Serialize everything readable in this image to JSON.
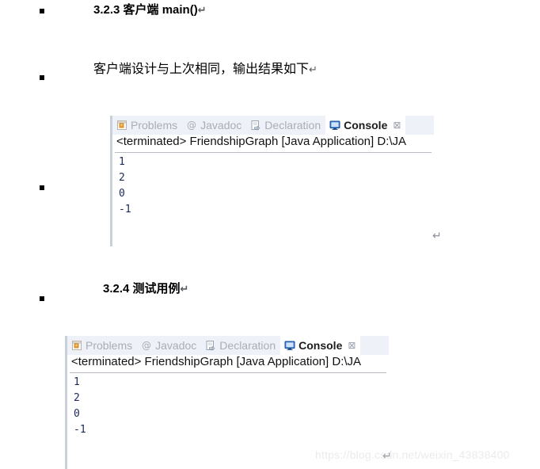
{
  "document": {
    "headings": [
      {
        "number": "3.2.3",
        "text": "客户端 main()",
        "mark": "↵"
      },
      {
        "number": "3.2.4",
        "text": "测试用例",
        "mark": "↵"
      }
    ],
    "paragraph": {
      "text": "客户端设计与上次相同，输出结果如下",
      "mark": "↵"
    },
    "heading_1_full": "3.2.3 客户端 main()",
    "heading_2_full": "3.2.4 测试用例",
    "loose_pilcrow": "↵"
  },
  "console_panels": [
    {
      "tabs": [
        {
          "icon": "problems-icon",
          "label": "Problems",
          "active": false
        },
        {
          "icon": "javadoc-icon",
          "label": "Javadoc",
          "active": false
        },
        {
          "icon": "declaration-icon",
          "label": "Declaration",
          "active": false
        },
        {
          "icon": "console-icon",
          "label": "Console",
          "active": true,
          "close": "⊠"
        }
      ],
      "launch_line": "<terminated> FriendshipGraph [Java Application] D:\\JA",
      "output_lines": [
        "1",
        "2",
        "0",
        "-1"
      ]
    },
    {
      "tabs": [
        {
          "icon": "problems-icon",
          "label": "Problems",
          "active": false
        },
        {
          "icon": "javadoc-icon",
          "label": "Javadoc",
          "active": false
        },
        {
          "icon": "declaration-icon",
          "label": "Declaration",
          "active": false
        },
        {
          "icon": "console-icon",
          "label": "Console",
          "active": true,
          "close": "⊠"
        }
      ],
      "launch_line": "<terminated> FriendshipGraph [Java Application] D:\\JA",
      "output_lines": [
        "1",
        "2",
        "0",
        "-1"
      ]
    }
  ],
  "watermark": {
    "text": "https://blog.csdn.net/weixin_43838400"
  },
  "colors": {
    "tabbar_bg": "#eef1f7",
    "left_rail": "#c9cfdb",
    "inactive_tab_text": "#a9adb6",
    "active_tab_text": "#1c1c1c",
    "console_output_text": "#1a2a56",
    "watermark_text": "#ebebeb",
    "rule": "#b9bcc2"
  }
}
